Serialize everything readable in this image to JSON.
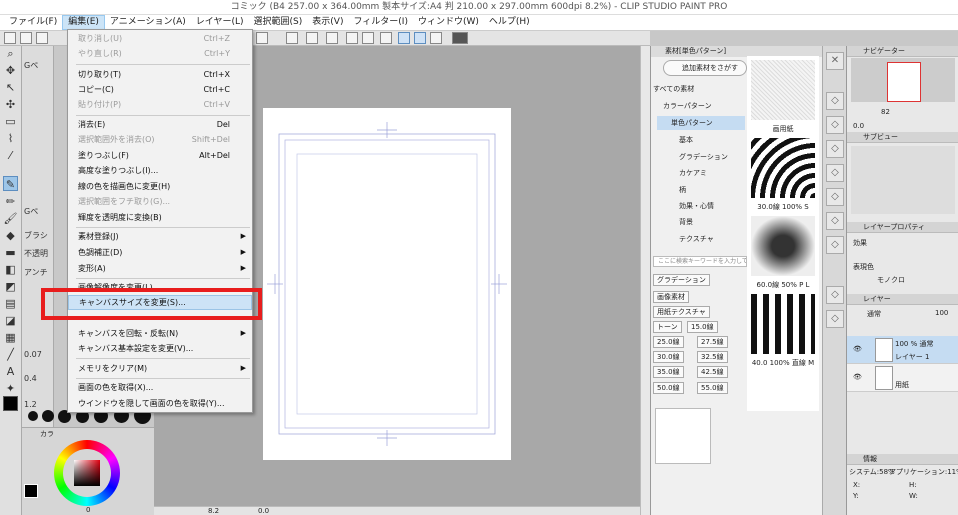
{
  "window": {
    "title": "コミック (B4 257.00 x 364.00mm 製本サイズ:A4 判 210.00 x 297.00mm 600dpi 8.2%) - CLIP STUDIO PAINT PRO"
  },
  "menubar": [
    "ファイル(F)",
    "編集(E)",
    "アニメーション(A)",
    "レイヤー(L)",
    "選択範囲(S)",
    "表示(V)",
    "フィルター(I)",
    "ウィンドウ(W)",
    "ヘルプ(H)"
  ],
  "edit_menu": {
    "items": [
      {
        "label": "取り消し(U)",
        "shortcut": "Ctrl+Z",
        "disabled": true
      },
      {
        "label": "やり直し(R)",
        "shortcut": "Ctrl+Y",
        "disabled": true
      },
      {
        "label": "切り取り(T)",
        "shortcut": "Ctrl+X"
      },
      {
        "label": "コピー(C)",
        "shortcut": "Ctrl+C"
      },
      {
        "label": "貼り付け(P)",
        "shortcut": "Ctrl+V",
        "disabled": true
      },
      {
        "label": "消去(E)",
        "shortcut": "Del"
      },
      {
        "label": "選択範囲外を消去(O)",
        "shortcut": "Shift+Del",
        "disabled": true
      },
      {
        "label": "塗りつぶし(F)",
        "shortcut": "Alt+Del"
      },
      {
        "label": "高度な塗りつぶし(I)..."
      },
      {
        "label": "線の色を描画色に変更(H)"
      },
      {
        "label": "選択範囲をフチ取り(G)...",
        "disabled": true
      },
      {
        "label": "輝度を透明度に変換(B)"
      },
      {
        "label": "素材登録(J)",
        "submenu": true
      },
      {
        "label": "色調補正(D)",
        "submenu": true
      },
      {
        "label": "変形(A)",
        "submenu": true
      },
      {
        "label": "画像解像度を変更(L)..."
      },
      {
        "label": "キャンバスサイズを変更(S)...",
        "highlighted": true
      },
      {
        "label": "キャンバスを回転・反転(N)",
        "submenu": true
      },
      {
        "label": "キャンバス基本設定を変更(V)..."
      },
      {
        "label": "メモリをクリア(M)",
        "submenu": true
      },
      {
        "label": "画面の色を取得(X)..."
      },
      {
        "label": "ウインドウを隠して画面の色を取得(Y)..."
      }
    ]
  },
  "subtool": {
    "tab": "Gペ",
    "brush_label": "ブラシ",
    "opacity_label": "不透明",
    "antialias_label": "アンチ",
    "sizes": [
      "0.07",
      "0.4",
      "1.2"
    ]
  },
  "color_panel": {
    "tab": "カラ",
    "value": "0"
  },
  "material": {
    "tab": "素材[単色パターン]",
    "add_button": "追加素材をさがす",
    "tree": [
      "すべての素材",
      "カラーパターン",
      "単色パターン",
      "基本",
      "グラデーション",
      "カケアミ",
      "柄",
      "効果・心情",
      "背景",
      "テクスチャ"
    ],
    "search_placeholder": "ここに検索キーワードを入力して",
    "tags": [
      "グラデーション",
      "画像素材",
      "用紙テクスチャ",
      "トーン",
      "15.0線",
      "25.0線",
      "27.5線",
      "30.0線",
      "32.5線",
      "35.0線",
      "42.5線",
      "50.0線",
      "55.0線"
    ],
    "thumbs": [
      "画用紙",
      "30.0線 100% S",
      "60.0線 50% P L",
      "40.0 100% 直線 M"
    ]
  },
  "navigator": {
    "tab": "ナビゲーター",
    "zoom": "82",
    "rotate": "0.0"
  },
  "subview": {
    "tab": "サブビュー"
  },
  "layer_property": {
    "tab": "レイヤープロパティ",
    "effect": "効果",
    "express": "表現色",
    "express_value": "モノクロ"
  },
  "layers": {
    "tab": "レイヤー",
    "blend": "通常",
    "opacity": "100",
    "rows": [
      {
        "name": "100 % 通常",
        "sub": "レイヤー 1",
        "selected": true
      },
      {
        "name": "用紙",
        "selected": false
      }
    ]
  },
  "info": {
    "tab": "情報",
    "system": "システム:58%",
    "app": "アプリケーション:11%",
    "x": "X:",
    "y": "Y:",
    "h": "H:",
    "w": "W:"
  },
  "status": {
    "zoom": "8.2",
    "angle": "0.0"
  },
  "colors": {
    "highlight_box": "#e81d1d",
    "menu_highlight": "#cde3f6"
  }
}
